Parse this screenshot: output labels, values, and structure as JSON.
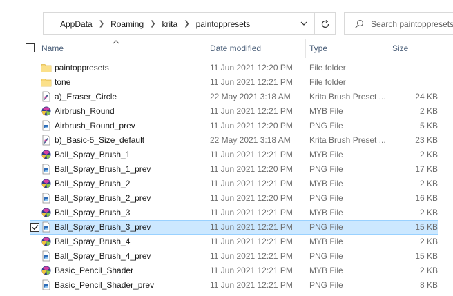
{
  "breadcrumb": [
    "AppData",
    "Roaming",
    "krita",
    "paintoppresets"
  ],
  "search": {
    "placeholder": "Search paintoppresets"
  },
  "columns": {
    "name": "Name",
    "date": "Date modified",
    "type": "Type",
    "size": "Size"
  },
  "files": [
    {
      "name": "paintoppresets",
      "date": "11 Jun 2021 12:20 PM",
      "type": "File folder",
      "size": "",
      "icon": "folder",
      "selected": false
    },
    {
      "name": "tone",
      "date": "11 Jun 2021 12:21 PM",
      "type": "File folder",
      "size": "",
      "icon": "folder",
      "selected": false
    },
    {
      "name": "a)_Eraser_Circle",
      "date": "22 May 2021 3:18 AM",
      "type": "Krita Brush Preset ...",
      "size": "24 KB",
      "icon": "krita",
      "selected": false
    },
    {
      "name": "Airbrush_Round",
      "date": "11 Jun 2021 12:21 PM",
      "type": "MYB File",
      "size": "2 KB",
      "icon": "myb",
      "selected": false
    },
    {
      "name": "Airbrush_Round_prev",
      "date": "11 Jun 2021 12:20 PM",
      "type": "PNG File",
      "size": "5 KB",
      "icon": "png",
      "selected": false
    },
    {
      "name": "b)_Basic-5_Size_default",
      "date": "22 May 2021 3:18 AM",
      "type": "Krita Brush Preset ...",
      "size": "23 KB",
      "icon": "krita",
      "selected": false
    },
    {
      "name": "Ball_Spray_Brush_1",
      "date": "11 Jun 2021 12:21 PM",
      "type": "MYB File",
      "size": "2 KB",
      "icon": "myb",
      "selected": false
    },
    {
      "name": "Ball_Spray_Brush_1_prev",
      "date": "11 Jun 2021 12:20 PM",
      "type": "PNG File",
      "size": "17 KB",
      "icon": "png",
      "selected": false
    },
    {
      "name": "Ball_Spray_Brush_2",
      "date": "11 Jun 2021 12:21 PM",
      "type": "MYB File",
      "size": "2 KB",
      "icon": "myb",
      "selected": false
    },
    {
      "name": "Ball_Spray_Brush_2_prev",
      "date": "11 Jun 2021 12:20 PM",
      "type": "PNG File",
      "size": "16 KB",
      "icon": "png",
      "selected": false
    },
    {
      "name": "Ball_Spray_Brush_3",
      "date": "11 Jun 2021 12:21 PM",
      "type": "MYB File",
      "size": "2 KB",
      "icon": "myb",
      "selected": false
    },
    {
      "name": "Ball_Spray_Brush_3_prev",
      "date": "11 Jun 2021 12:21 PM",
      "type": "PNG File",
      "size": "15 KB",
      "icon": "png",
      "selected": true
    },
    {
      "name": "Ball_Spray_Brush_4",
      "date": "11 Jun 2021 12:21 PM",
      "type": "MYB File",
      "size": "2 KB",
      "icon": "myb",
      "selected": false
    },
    {
      "name": "Ball_Spray_Brush_4_prev",
      "date": "11 Jun 2021 12:21 PM",
      "type": "PNG File",
      "size": "15 KB",
      "icon": "png",
      "selected": false
    },
    {
      "name": "Basic_Pencil_Shader",
      "date": "11 Jun 2021 12:21 PM",
      "type": "MYB File",
      "size": "2 KB",
      "icon": "myb",
      "selected": false
    },
    {
      "name": "Basic_Pencil_Shader_prev",
      "date": "11 Jun 2021 12:21 PM",
      "type": "PNG File",
      "size": "8 KB",
      "icon": "png",
      "selected": false
    }
  ]
}
